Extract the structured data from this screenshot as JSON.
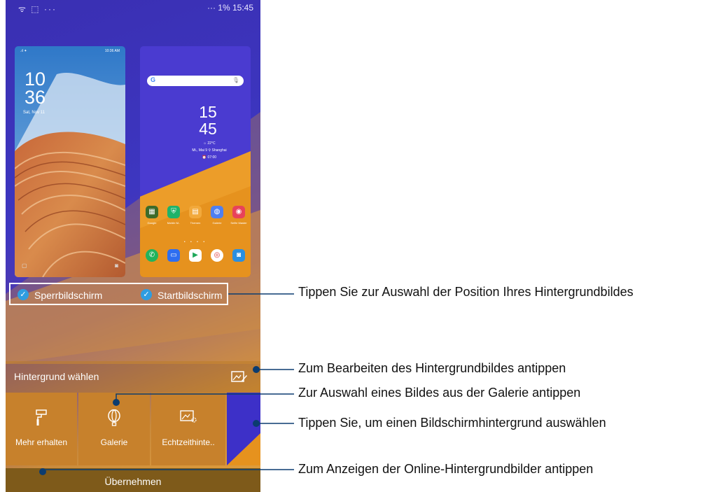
{
  "status_bar": {
    "left": "ᯤ ⬚ ···",
    "right": "··· 1% 15:45"
  },
  "lock_preview": {
    "status_time": "10:36 AM",
    "clock": [
      "10",
      "36"
    ],
    "date": "Sat, Nov 11"
  },
  "home_preview": {
    "search_g": "G",
    "clock": [
      "15",
      "45"
    ],
    "weather": "☼ 22°C",
    "location": "Mi., Mai 9 ⚲ Shanghai",
    "alarm": "⏰ 07:00",
    "apps_row1": [
      "Google",
      "Mobile M..",
      "Themen",
      "Galerie",
      "Selfie Master"
    ],
    "dots": "• • • •"
  },
  "selection": {
    "lock_label": "Sperrbildschirm",
    "home_label": "Startbildschirm"
  },
  "panel": {
    "title": "Hintergrund wählen",
    "tiles": [
      "Mehr erhalten",
      "Galerie",
      "Echtzeithinte.."
    ],
    "apply": "Übernehmen"
  },
  "callouts": {
    "position": "Tippen Sie zur Auswahl der Position Ihres Hintergrundbildes",
    "edit": "Zum Bearbeiten des Hintergrundbildes antippen",
    "gallery": "Zur Auswahl eines Bildes aus der Galerie antippen",
    "select": "Tippen Sie, um einen Bildschirmhintergrund auswählen",
    "online": "Zum Anzeigen der Online-Hintergrundbilder antippen"
  },
  "colors": {
    "accent": "#2f9de0",
    "purple": "#3d36c0",
    "orange": "#e6a23a"
  }
}
